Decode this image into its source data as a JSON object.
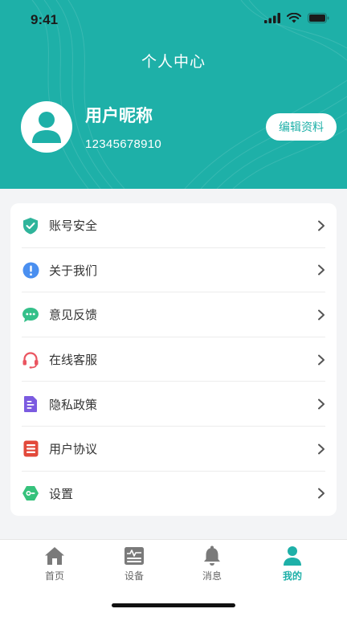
{
  "status_bar": {
    "time": "9:41"
  },
  "header": {
    "title": "个人中心",
    "nickname": "用户昵称",
    "phone": "12345678910",
    "edit_button": "编辑资料",
    "accent_color": "#1eb0a8"
  },
  "menu": {
    "items": [
      {
        "label": "账号安全",
        "icon": "shield-check-icon",
        "color": "#2fb49b"
      },
      {
        "label": "关于我们",
        "icon": "info-icon",
        "color": "#4a8ff0"
      },
      {
        "label": "意见反馈",
        "icon": "chat-bubble-icon",
        "color": "#34c08a"
      },
      {
        "label": "在线客服",
        "icon": "headset-icon",
        "color": "#ea5560"
      },
      {
        "label": "隐私政策",
        "icon": "document-icon",
        "color": "#7b5be0"
      },
      {
        "label": "用户协议",
        "icon": "agreement-icon",
        "color": "#e2493b"
      },
      {
        "label": "设置",
        "icon": "settings-icon",
        "color": "#36c27c"
      }
    ]
  },
  "tab_bar": {
    "tabs": [
      {
        "label": "首页",
        "icon": "home-icon",
        "active": false
      },
      {
        "label": "设备",
        "icon": "device-icon",
        "active": false
      },
      {
        "label": "消息",
        "icon": "bell-icon",
        "active": false
      },
      {
        "label": "我的",
        "icon": "user-icon",
        "active": true
      }
    ]
  }
}
